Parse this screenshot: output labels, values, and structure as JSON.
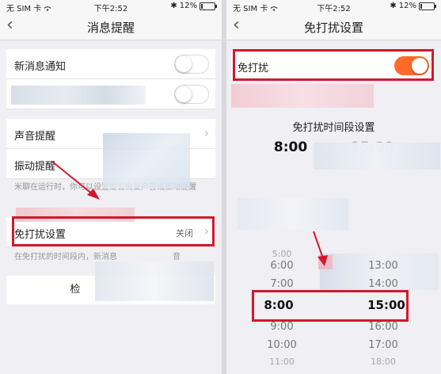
{
  "status_bar": {
    "carrier": "无 SIM 卡",
    "time": "下午2:52",
    "battery": "12%",
    "battery_level": 0.12
  },
  "left": {
    "nav": {
      "back": "‹",
      "title": "消息提醒"
    },
    "rows": {
      "new_message": {
        "label": "新消息通知",
        "on": false
      },
      "sound": {
        "label": "声音提醒"
      },
      "vibrate": {
        "label": "振动提醒"
      },
      "dnd": {
        "label": "免打扰设置",
        "value": "关闭"
      }
    },
    "note_running": "米聊在运行时，你可以设置是否需要声音或振动提醒",
    "note_dnd": "在免打扰的时间段内，新消息",
    "note_dnd_tail": "音",
    "check_button": "检"
  },
  "right": {
    "nav": {
      "back": "‹",
      "title": "免打扰设置"
    },
    "dnd_row": {
      "label": "免打扰",
      "on": true
    },
    "section_title": "免打扰时间段设置",
    "time_start": "8:00",
    "time_range_tail": "- 15:00",
    "picker": {
      "left": {
        "above": [
          "5:00",
          "6:00",
          "7:00"
        ],
        "selected": "8:00",
        "below": [
          "9:00",
          "10:00",
          "11:00"
        ]
      },
      "right": {
        "above": [
          "13:00",
          "14:00"
        ],
        "selected": "15:00",
        "below": [
          "16:00",
          "17:00",
          "18:00"
        ]
      }
    }
  },
  "colors": {
    "accent": "#ff6a2a",
    "highlight": "#d4182a"
  },
  "icons": {
    "wifi": "wifi-icon",
    "back": "back-chevron-icon",
    "chevron": "chevron-right-icon"
  }
}
